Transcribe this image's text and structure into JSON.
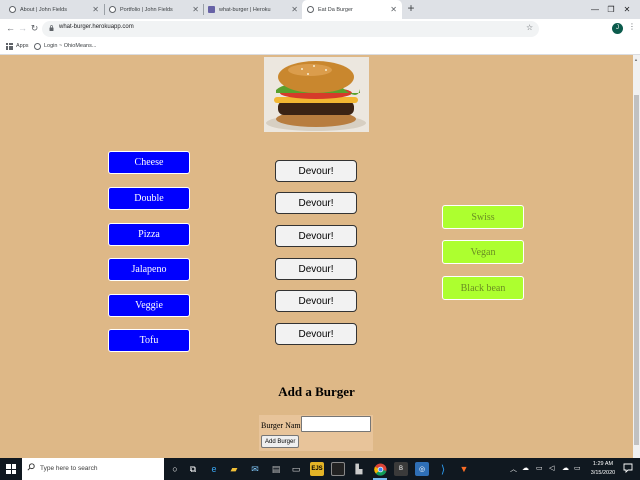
{
  "tabs": [
    {
      "title": "About | John Fields",
      "active": false
    },
    {
      "title": "Portfolio | John Fields",
      "active": false
    },
    {
      "title": "what-burger | Heroku",
      "active": false
    },
    {
      "title": "Eat Da Burger",
      "active": true
    }
  ],
  "toolbar": {
    "url": "what-burger.herokuapp.com"
  },
  "bookmarks": {
    "apps_label": "Apps",
    "items": [
      {
        "label": "Login ~ OhioMeans..."
      }
    ]
  },
  "page": {
    "uneaten": [
      {
        "name": "Cheese",
        "action": "Devour!"
      },
      {
        "name": "Double",
        "action": "Devour!"
      },
      {
        "name": "Pizza",
        "action": "Devour!"
      },
      {
        "name": "Jalapeno",
        "action": "Devour!"
      },
      {
        "name": "Veggie",
        "action": "Devour!"
      },
      {
        "name": "Tofu",
        "action": "Devour!"
      }
    ],
    "devoured": [
      "Swiss",
      "Vegan",
      "Black bean"
    ],
    "form": {
      "heading": "Add a Burger",
      "name_label": "Burger Name:",
      "name_value": "",
      "submit_label": "Add Burger"
    },
    "colors": {
      "background": "#deb887",
      "uneaten_button": "#0000ff",
      "devoured_button": "#adff2f"
    }
  },
  "taskbar": {
    "search_placeholder": "Type here to search",
    "time": "1:29 AM",
    "date": "3/15/2020",
    "pinned": [
      "task-view-icon",
      "edge-icon",
      "file-explorer-icon",
      "mail-icon",
      "store-icon",
      "terminal-icon",
      "ejs-icon",
      "cmd-icon",
      "chrome-icon",
      "app-icon",
      "vscode-like-icon",
      "vscode-icon",
      "gitlab-icon"
    ]
  }
}
